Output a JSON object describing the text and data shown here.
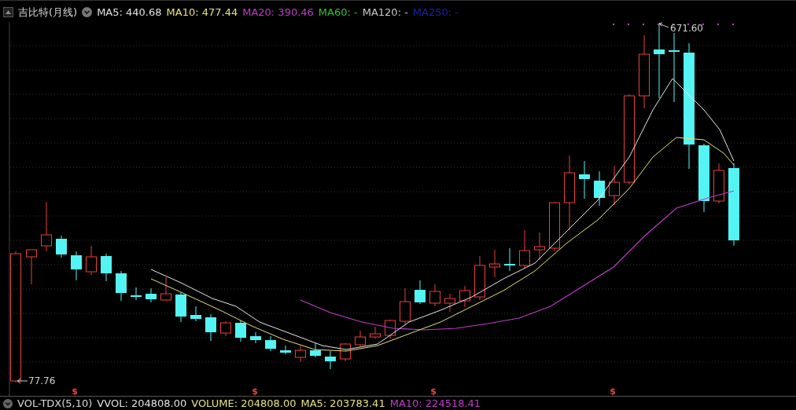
{
  "header": {
    "title": "吉比特(月线)",
    "indicators": [
      {
        "label": "MA5: 440.68",
        "color": "#e0e0e0"
      },
      {
        "label": "MA10: 477.44",
        "color": "#e6e27a"
      },
      {
        "label": "MA20: 390.46",
        "color": "#c03cc8"
      },
      {
        "label": "MA60: -",
        "color": "#34c034"
      },
      {
        "label": "MA120: -",
        "color": "#c8c8c8"
      },
      {
        "label": "MA250: -",
        "color": "#1c22a8"
      }
    ]
  },
  "chart": {
    "high_label": "671.60",
    "low_label": "77.76",
    "dividend_markers": [
      "$",
      "$",
      "$",
      "$"
    ]
  },
  "footer": {
    "title": "VOL-TDX(5,10)",
    "indicators": [
      {
        "label": "VVOL: 204808.00",
        "color": "#e0e0e0"
      },
      {
        "label": "VOLUME: 204808.00",
        "color": "#e6e27a"
      },
      {
        "label": "MA5: 203783.41",
        "color": "#e6e27a"
      },
      {
        "label": "MA10: 224518.41",
        "color": "#c03cc8"
      }
    ]
  }
}
